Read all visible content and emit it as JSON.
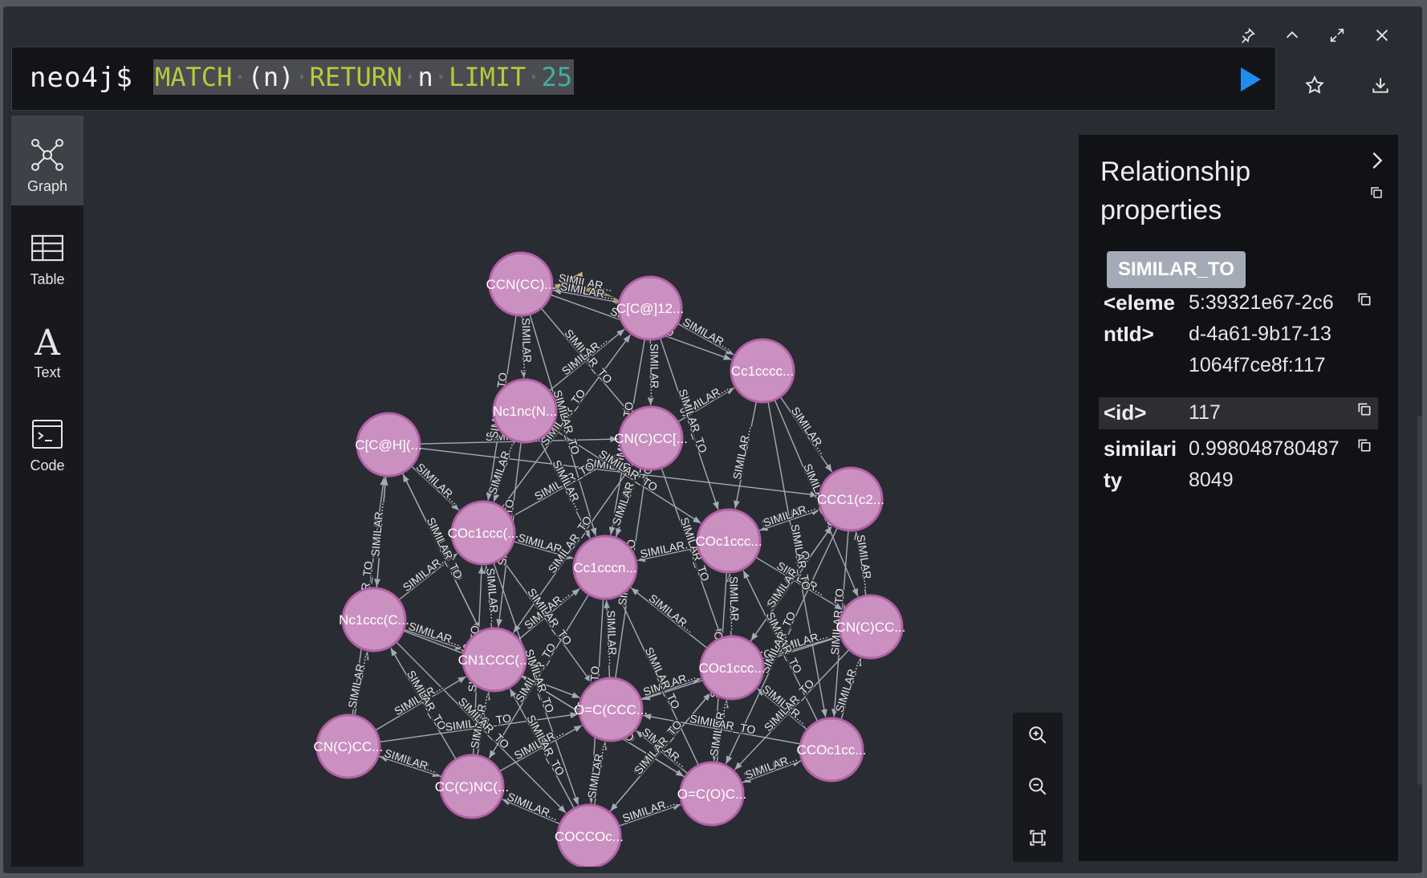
{
  "window": {
    "controls": [
      "pin-icon",
      "collapse-up-icon",
      "expand-icon",
      "close-icon"
    ]
  },
  "editor": {
    "prompt": "neo4j$",
    "query": {
      "kw1": "MATCH",
      "var1": "(n)",
      "kw2": "RETURN",
      "var2": "n",
      "kw3": "LIMIT",
      "limit": "25"
    }
  },
  "sidebar": {
    "items": [
      {
        "label": "Graph",
        "icon": "graph-icon",
        "active": true
      },
      {
        "label": "Table",
        "icon": "table-icon",
        "active": false
      },
      {
        "label": "Text",
        "icon": "text-icon",
        "active": false
      },
      {
        "label": "Code",
        "icon": "code-icon",
        "active": false
      }
    ]
  },
  "graph": {
    "node_color": "#c990c0",
    "node_border": "#b261a5",
    "edge_color": "#a5abb6",
    "highlight_edge_color": "#c9b37e",
    "edge_label": "SIMILAR_TO",
    "edge_label_short": "SIMILAR...",
    "highlight_label": "SIMILAR...",
    "nodes": [
      {
        "label": "CCN(CC)..."
      },
      {
        "label": "C[C@]12..."
      },
      {
        "label": "Cc1cccc..."
      },
      {
        "label": "Nc1nc(N..."
      },
      {
        "label": "CN(C)CC[..."
      },
      {
        "label": "C[C@H](..."
      },
      {
        "label": "CCC1(c2..."
      },
      {
        "label": "COc1ccc(..."
      },
      {
        "label": "COc1ccc..."
      },
      {
        "label": "Cc1cccn..."
      },
      {
        "label": "Nc1ccc(C..."
      },
      {
        "label": "CN(C)CC..."
      },
      {
        "label": "CN1CCC(..."
      },
      {
        "label": "COc1ccc..."
      },
      {
        "label": "O=C(CCC..."
      },
      {
        "label": "CN(C)CC..."
      },
      {
        "label": "CCOc1cc..."
      },
      {
        "label": "CC(C)NC(..."
      },
      {
        "label": "O=C(O)C..."
      },
      {
        "label": "COCCOc..."
      }
    ]
  },
  "zoom": [
    "zoom-in-icon",
    "zoom-out-icon",
    "fit-icon"
  ],
  "properties": {
    "title": "Relationship properties",
    "type": "SIMILAR_TO",
    "rows": [
      {
        "key": "<elementId>",
        "value": "5:39321e67-2c6d-4a61-9b17-131064f7ce8f:117"
      },
      {
        "key": "<id>",
        "value": "117"
      },
      {
        "key": "similarity",
        "value": "0.9980487804878049"
      }
    ]
  }
}
